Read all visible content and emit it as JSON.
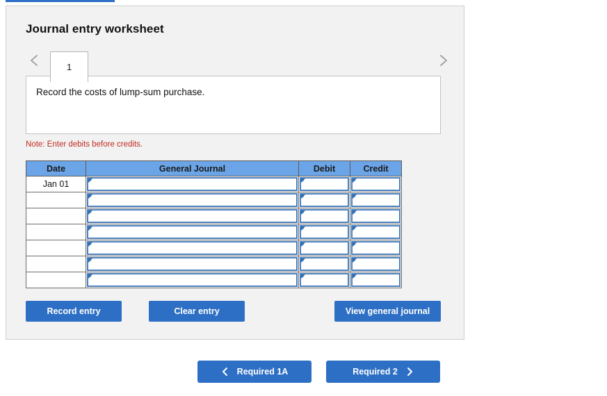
{
  "top_progress_bar": {
    "color": "#2D6FC4"
  },
  "panel": {
    "title": "Journal entry worksheet",
    "background": "#F2F2F2"
  },
  "tabs": {
    "prev_icon": "chevron-left-icon",
    "next_icon": "chevron-right-icon",
    "items": [
      {
        "label": "1",
        "active": true
      }
    ]
  },
  "description": {
    "text": "Record the costs of lump-sum purchase."
  },
  "note": {
    "text": "Note: Enter debits before credits.",
    "color": "#C32B20"
  },
  "journal_table": {
    "header_color": "#6BA5E7",
    "columns": [
      "Date",
      "General Journal",
      "Debit",
      "Credit"
    ],
    "rows": [
      {
        "date": "Jan 01",
        "general_journal": "",
        "debit": "",
        "credit": ""
      },
      {
        "date": "",
        "general_journal": "",
        "debit": "",
        "credit": ""
      },
      {
        "date": "",
        "general_journal": "",
        "debit": "",
        "credit": ""
      },
      {
        "date": "",
        "general_journal": "",
        "debit": "",
        "credit": ""
      },
      {
        "date": "",
        "general_journal": "",
        "debit": "",
        "credit": ""
      },
      {
        "date": "",
        "general_journal": "",
        "debit": "",
        "credit": ""
      },
      {
        "date": "",
        "general_journal": "",
        "debit": "",
        "credit": ""
      }
    ]
  },
  "actions": {
    "record_entry": "Record entry",
    "clear_entry": "Clear entry",
    "view_general_journal": "View general journal",
    "button_color": "#2D6FC4"
  },
  "footer_nav": {
    "prev_label": "Required 1A",
    "prev_icon": "chevron-left-icon",
    "next_label": "Required 2",
    "next_icon": "chevron-right-icon"
  }
}
